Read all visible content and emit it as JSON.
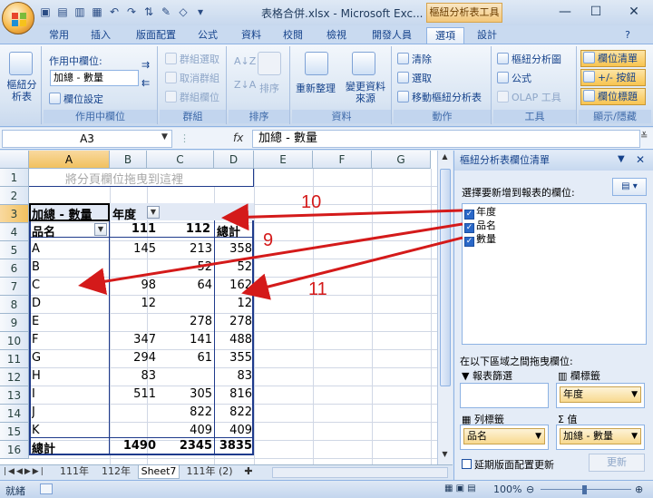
{
  "window": {
    "title": "表格合併.xlsx - Microsoft Exc...",
    "pivot_tools_label": "樞紐分析表工具",
    "minimize": "—",
    "maximize": "☐",
    "close": "✕"
  },
  "tabs": [
    "常用",
    "插入",
    "版面配置",
    "公式",
    "資料",
    "校閱",
    "檢視",
    "開發人員",
    "選項",
    "設計"
  ],
  "active_tab": "選項",
  "ribbon": {
    "pivot_table": {
      "big_button": "樞紐分析表",
      "group_label": ""
    },
    "active_field": {
      "label": "作用中欄位:",
      "field_value": "加總 - 數量",
      "settings": "欄位設定",
      "group_label": "作用中欄位"
    },
    "group": {
      "items": [
        "群組選取",
        "取消群組",
        "群組欄位"
      ],
      "group_label": "群組"
    },
    "sort": {
      "item": "排序",
      "group_label": "排序"
    },
    "data": {
      "refresh": "重新整理",
      "change_source": "變更資料來源",
      "group_label": "資料"
    },
    "actions": {
      "items": [
        "清除",
        "選取",
        "移動樞紐分析表"
      ],
      "group_label": "動作"
    },
    "tools": {
      "items": [
        "樞紐分析圖",
        "公式",
        "OLAP 工具"
      ],
      "group_label": "工具"
    },
    "show_hide": {
      "items": [
        "欄位清單",
        "+/- 按鈕",
        "欄位標題"
      ],
      "group_label": "顯示/隱藏"
    }
  },
  "formula_bar": {
    "name_box": "A3",
    "fx": "fx",
    "value": "加總 - 數量"
  },
  "grid": {
    "columns": [
      "A",
      "B",
      "C",
      "D",
      "E",
      "F",
      "G"
    ],
    "rows": [
      "1",
      "2",
      "3",
      "4",
      "5",
      "6",
      "7",
      "8",
      "9",
      "10",
      "11",
      "12",
      "13",
      "14",
      "15",
      "16"
    ],
    "page_field_hint": "將分頁欄位拖曳到這裡",
    "data_field_label": "加總 - 數量",
    "col_field_label": "年度",
    "row_field_label": "品名",
    "col_years": [
      "111",
      "112"
    ],
    "total_label": "總計",
    "data_rows": [
      {
        "name": "A",
        "y111": "145",
        "y112": "213",
        "total": "358"
      },
      {
        "name": "B",
        "y111": "",
        "y112": "52",
        "total": "52"
      },
      {
        "name": "C",
        "y111": "98",
        "y112": "64",
        "total": "162"
      },
      {
        "name": "D",
        "y111": "12",
        "y112": "",
        "total": "12"
      },
      {
        "name": "E",
        "y111": "",
        "y112": "278",
        "total": "278"
      },
      {
        "name": "F",
        "y111": "347",
        "y112": "141",
        "total": "488"
      },
      {
        "name": "G",
        "y111": "294",
        "y112": "61",
        "total": "355"
      },
      {
        "name": "H",
        "y111": "83",
        "y112": "",
        "total": "83"
      },
      {
        "name": "I",
        "y111": "511",
        "y112": "305",
        "total": "816"
      },
      {
        "name": "J",
        "y111": "",
        "y112": "822",
        "total": "822"
      },
      {
        "name": "K",
        "y111": "",
        "y112": "409",
        "total": "409"
      }
    ],
    "grand_total": {
      "label": "總計",
      "y111": "1490",
      "y112": "2345",
      "total": "3835"
    }
  },
  "sheet_tabs": [
    "111年",
    "112年",
    "Sheet7",
    "111年 (2)"
  ],
  "active_sheet": "Sheet7",
  "status": {
    "mode": "就緒",
    "zoom": "100%"
  },
  "field_panel": {
    "title": "樞紐分析表欄位清單",
    "choose_label": "選擇要新增到報表的欄位:",
    "fields": [
      "年度",
      "品名",
      "數量"
    ],
    "drag_label": "在以下區域之間拖曳欄位:",
    "report_filter_label": "報表篩選",
    "column_labels_label": "欄標籤",
    "row_labels_label": "列標籤",
    "values_label": "值",
    "column_item": "年度",
    "row_item": "品名",
    "value_item": "加總 - 數量",
    "defer_label": "延期版面配置更新",
    "update_button": "更新"
  },
  "annotations": [
    "10",
    "9",
    "11"
  ],
  "colors": {
    "annotation": "#d41a1a",
    "pivot_border": "#1f3b8c",
    "highlight": "#f8c451"
  }
}
